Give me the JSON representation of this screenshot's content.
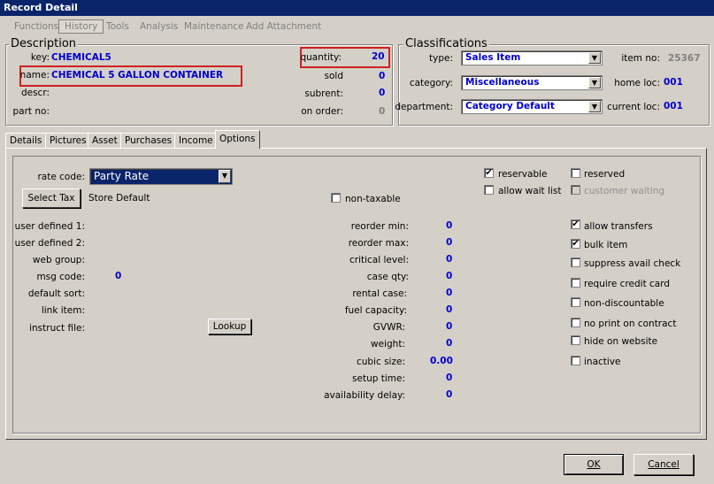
{
  "window": {
    "title": "Record Detail"
  },
  "menu": {
    "functions": "Functions",
    "history": "History",
    "tools": "Tools",
    "analysis": "Analysis",
    "maintenance": "Maintenance",
    "add_attachment": "Add Attachment"
  },
  "description": {
    "title": "Description",
    "key_label": "key:",
    "key_value": "CHEMICAL5",
    "name_label": "name:",
    "name_value": "CHEMICAL 5 GALLON CONTAINER",
    "descr_label": "descr:",
    "part_no_label": "part no:",
    "quantity_label": "quantity:",
    "quantity_value": "20",
    "sold_label": "sold",
    "sold_value": "0",
    "subrent_label": "subrent:",
    "subrent_value": "0",
    "on_order_label": "on order:",
    "on_order_value": "0"
  },
  "classifications": {
    "title": "Classifications",
    "type_label": "type:",
    "type_value": "Sales Item",
    "category_label": "category:",
    "category_value": "Miscellaneous",
    "department_label": "department:",
    "department_value": "Category Default",
    "item_no_label": "item no:",
    "item_no_value": "25367",
    "home_loc_label": "home loc:",
    "home_loc_value": "001",
    "current_loc_label": "current loc:",
    "current_loc_value": "001"
  },
  "tabs": {
    "details": "Details",
    "pictures": "Pictures",
    "asset": "Asset",
    "purchases": "Purchases",
    "income": "Income",
    "options": "Options"
  },
  "options": {
    "rate_code_label": "rate code:",
    "rate_code_value": "Party Rate",
    "select_tax_button": "Select Tax",
    "tax_value": "Store Default",
    "non_taxable_label": "non-taxable",
    "user_defined_1_label": "user defined 1:",
    "user_defined_2_label": "user defined 2:",
    "web_group_label": "web group:",
    "msg_code_label": "msg code:",
    "msg_code_value": "0",
    "default_sort_label": "default sort:",
    "link_item_label": "link item:",
    "instruct_file_label": "instruct file:",
    "lookup_button": "Lookup",
    "reorder_min_label": "reorder min:",
    "reorder_min_value": "0",
    "reorder_max_label": "reorder max:",
    "reorder_max_value": "0",
    "critical_level_label": "critical level:",
    "critical_level_value": "0",
    "case_qty_label": "case qty:",
    "case_qty_value": "0",
    "rental_case_label": "rental case:",
    "rental_case_value": "0",
    "fuel_capacity_label": "fuel capacity:",
    "fuel_capacity_value": "0",
    "gvwr_label": "GVWR:",
    "gvwr_value": "0",
    "weight_label": "weight:",
    "weight_value": "0",
    "cubic_size_label": "cubic size:",
    "cubic_size_value": "0.00",
    "setup_time_label": "setup time:",
    "setup_time_value": "0",
    "availability_delay_label": "availability delay:",
    "availability_delay_value": "0",
    "reservable_label": "reservable",
    "reserved_label": "reserved",
    "allow_wait_list_label": "allow wait list",
    "customer_waiting_label": "customer waiting",
    "allow_transfers_label": "allow transfers",
    "bulk_item_label": "bulk item",
    "suppress_avail_check_label": "suppress avail check",
    "require_credit_card_label": "require credit card",
    "non_discountable_label": "non-discountable",
    "no_print_on_contract_label": "no print on contract",
    "hide_on_website_label": "hide on website",
    "inactive_label": "inactive",
    "check_mark": "✔"
  },
  "footer": {
    "ok": "OK",
    "cancel": "Cancel"
  }
}
